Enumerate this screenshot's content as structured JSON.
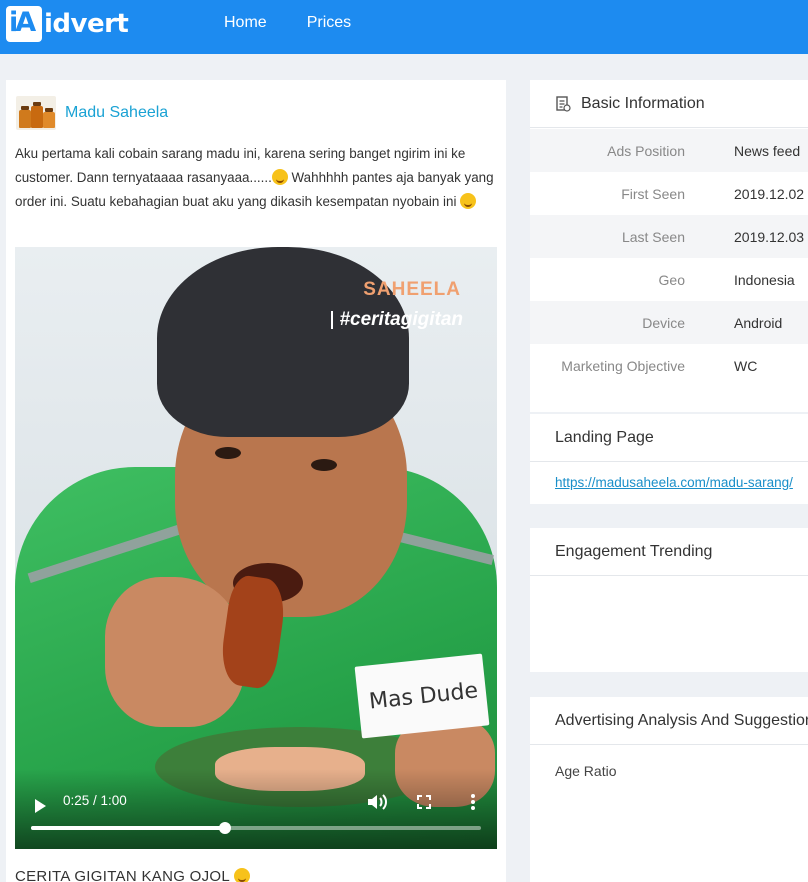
{
  "header": {
    "logo_text": "idvert",
    "logo_mark": "iA",
    "nav": [
      {
        "label": "Home"
      },
      {
        "label": "Prices"
      }
    ]
  },
  "post": {
    "advertiser": "Madu Saheela",
    "text_part1": "Aku pertama kali cobain sarang madu ini, karena sering banget ngirim ini ke customer. Dann ternyataaaa rasanyaaa......",
    "text_part2": " Wahhhhh pantes aja banyak yang order ini. Suatu kebahagian buat aku yang dikasih kesempatan nyobain ini ",
    "video": {
      "brand_overlay": "SAHEELA",
      "hashtag_overlay": "#ceritagigitan",
      "name_tag": "Mas Dude",
      "time": "0:25 / 1:00",
      "progress": 0.43,
      "icons": [
        "play-icon",
        "volume-icon",
        "fullscreen-icon",
        "more-options-icon"
      ]
    },
    "title": "CERITA GIGITAN KANG OJOL"
  },
  "basic_info": {
    "title": "Basic Information",
    "rows": [
      {
        "label": "Ads Position",
        "value": "News feed"
      },
      {
        "label": "First Seen",
        "value": "2019.12.02"
      },
      {
        "label": "Last Seen",
        "value": "2019.12.03"
      },
      {
        "label": "Geo",
        "value": "Indonesia"
      },
      {
        "label": "Device",
        "value": "Android"
      },
      {
        "label": "Marketing Objective",
        "value": "WC"
      }
    ]
  },
  "landing_page": {
    "title": "Landing Page",
    "url": "https://madusaheela.com/madu-sarang/"
  },
  "engagement": {
    "title": "Engagement Trending"
  },
  "analysis": {
    "title": "Advertising Analysis And Suggestions",
    "age_label": "Age Ratio"
  },
  "colors": {
    "header": "#1d8bf0",
    "link": "#1aa2d4",
    "page_bg": "#eef1f5"
  }
}
